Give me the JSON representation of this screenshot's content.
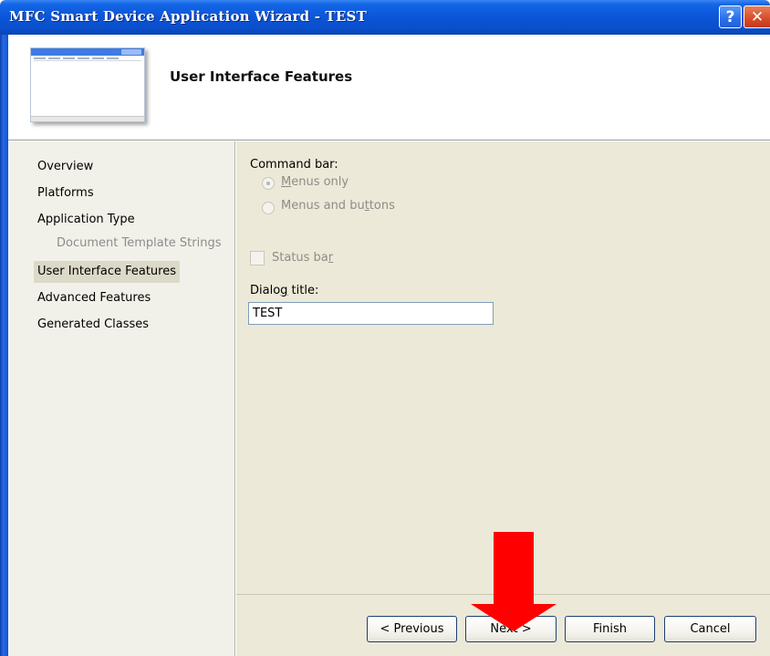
{
  "window": {
    "title": "MFC Smart Device Application Wizard - TEST",
    "help_label": "?",
    "close_label": "✕"
  },
  "header": {
    "heading": "User Interface Features",
    "thumbnail_icon": "window-preview-icon"
  },
  "nav": {
    "items": [
      {
        "label": "Overview",
        "state": "normal"
      },
      {
        "label": "Platforms",
        "state": "normal"
      },
      {
        "label": "Application Type",
        "state": "normal"
      },
      {
        "label": "Document Template Strings",
        "state": "disabled"
      },
      {
        "label": "User Interface Features",
        "state": "selected"
      },
      {
        "label": "Advanced Features",
        "state": "normal"
      },
      {
        "label": "Generated Classes",
        "state": "normal"
      }
    ]
  },
  "main": {
    "command_bar_label": "Command bar:",
    "radio_menus_only": {
      "pre": "",
      "key": "M",
      "post": "enus only",
      "checked": true
    },
    "radio_menus_buttons": {
      "pre": "Menus and bu",
      "key": "t",
      "post": "tons",
      "checked": false
    },
    "status_bar": {
      "pre": "Status ba",
      "key": "r",
      "post": "",
      "checked": false
    },
    "dialog_title_label": {
      "pre": "Dialo",
      "key": "g",
      "post": " title:"
    },
    "dialog_title_value": "TEST"
  },
  "buttons": {
    "previous": "< Previous",
    "next": "Next >",
    "finish": "Finish",
    "cancel": "Cancel"
  },
  "colors": {
    "titlebar": "#0b55d8",
    "dialog_face": "#ece9d8",
    "annotation_arrow": "#ff0000"
  }
}
